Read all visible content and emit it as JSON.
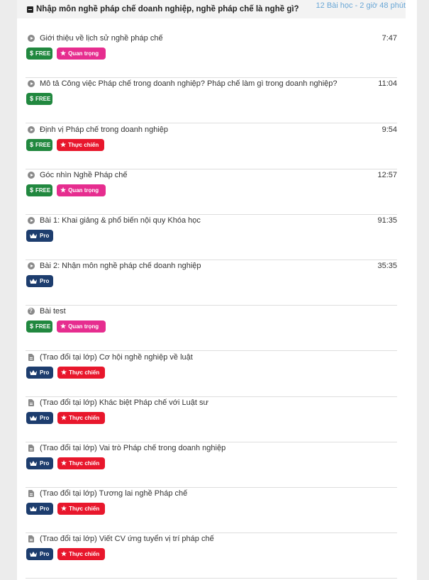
{
  "section": {
    "title": "Nhập môn nghề pháp chế doanh nghiệp, nghề pháp chế là nghề gì?",
    "meta": "12 Bài học - 2 giờ 48 phút"
  },
  "badges": {
    "free": "FREE",
    "important": "Quan trọng",
    "practical": "Thực chiến",
    "pro": "Pro"
  },
  "lessons": [
    {
      "title": "Giới thiệu về lịch sử nghề pháp chế",
      "duration": "7:47",
      "icon": "play-icon"
    },
    {
      "title": "Mô tả Công việc Pháp chế trong doanh nghiệp? Pháp chế làm gì trong doanh nghiệp?",
      "duration": "11:04",
      "icon": "play-icon"
    },
    {
      "title": "Định vị Pháp chế trong doanh nghiệp",
      "duration": "9:54",
      "icon": "play-icon"
    },
    {
      "title": "Góc nhìn Nghề Pháp chế",
      "duration": "12:57",
      "icon": "play-icon"
    },
    {
      "title": "Bài 1: Khai giảng & phổ biến nội quy Khóa học",
      "duration": "91:35",
      "icon": "play-icon"
    },
    {
      "title": "Bài 2: Nhận môn nghề pháp chế doanh nghiệp",
      "duration": "35:35",
      "icon": "play-icon"
    },
    {
      "title": "Bài test",
      "duration": "",
      "icon": "question-icon"
    },
    {
      "title": "(Trao đổi tại lớp) Cơ hội nghề nghiệp về luật",
      "duration": "",
      "icon": "document-icon"
    },
    {
      "title": "(Trao đổi tại lớp) Khác biệt Pháp chế với Luật sư",
      "duration": "",
      "icon": "document-icon"
    },
    {
      "title": "(Trao đổi tại lớp) Vai trò Pháp chế trong doanh nghiệp",
      "duration": "",
      "icon": "document-icon"
    },
    {
      "title": "(Trao đổi tại lớp) Tương lai nghề Pháp chế",
      "duration": "",
      "icon": "document-icon"
    },
    {
      "title": "(Trao đổi tại lớp) Viết CV ứng tuyển vị trí pháp chế",
      "duration": "",
      "icon": "document-icon"
    }
  ]
}
